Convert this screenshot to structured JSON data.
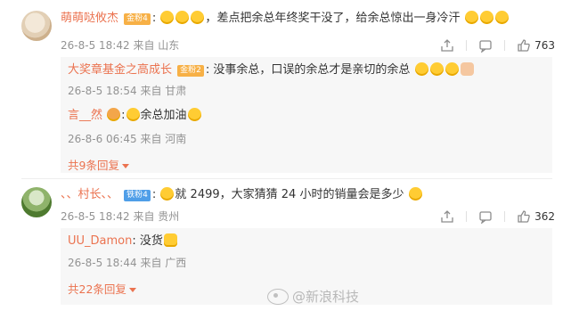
{
  "comments": [
    {
      "username": "萌萌哒攸杰",
      "badge": "金粉4",
      "text": "差点把余总年终奖干没了，给余总惊出一身冷汗",
      "time": "26-8-5 18:42",
      "location": "来自 山东",
      "likes": "763",
      "replies": [
        {
          "username": "大奖章基金之高成长",
          "badge": "金粉2",
          "text": "没事余总，口误的余总才是亲切的余总",
          "time": "26-8-5 18:54",
          "location": "来自 甘肃"
        },
        {
          "username": "言__然",
          "text": "余总加油",
          "time": "26-8-6 06:45",
          "location": "来自 河南"
        }
      ],
      "more_replies": "共9条回复"
    },
    {
      "username": "、、村长、、",
      "badge": "铁粉4",
      "text": "就 2499，大家猜猜 24 小时的销量会是多少",
      "time": "26-8-5 18:42",
      "location": "来自 贵州",
      "likes": "362",
      "replies": [
        {
          "username": "UU_Damon",
          "text": "没货",
          "time": "26-8-5 18:44",
          "location": "来自 广西"
        }
      ],
      "more_replies": "共22条回复"
    }
  ],
  "watermark": "@新浪科技",
  "colors": {
    "username": "#eb7350",
    "meta": "#939393",
    "reply_bg": "#f7f7f7"
  },
  "icons": [
    "share-icon",
    "comment-icon",
    "like-icon"
  ]
}
